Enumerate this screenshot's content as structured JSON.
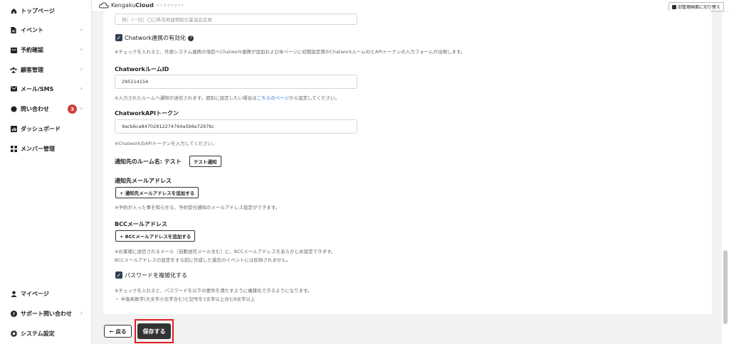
{
  "sidebar": {
    "items": [
      {
        "label": "トップページ",
        "icon": "home-icon"
      },
      {
        "label": "イベント",
        "icon": "document-icon",
        "chevron": "›"
      },
      {
        "label": "予約確認",
        "icon": "calendar-icon",
        "chevron": "›"
      },
      {
        "label": "顧客管理",
        "icon": "users-icon",
        "chevron": "›"
      },
      {
        "label": "メール/SMS",
        "icon": "mail-icon",
        "chevron": "›"
      },
      {
        "label": "問い合わせ",
        "icon": "chat-icon",
        "chevron": "›",
        "badge": "3"
      },
      {
        "label": "ダッシュボード",
        "icon": "chart-icon"
      },
      {
        "label": "メンバー管理",
        "icon": "grid-icon"
      }
    ],
    "bottom_items": [
      {
        "label": "マイページ",
        "icon": "person-icon"
      },
      {
        "label": "サポート問い合わせ",
        "icon": "question-icon",
        "chevron": "›"
      },
      {
        "label": "システム設定",
        "icon": "gear-icon"
      }
    ]
  },
  "header": {
    "logo_prefix": "Kengaku",
    "logo_bold": "Cloud",
    "logo_sub": "ケンガククラウド",
    "switch_label": "旧管理画面に切り替え"
  },
  "form": {
    "org_placeholder": "例）（一社）〇〇県宅地建物取引業協会会員",
    "chatwork_enable_label": "Chatwork連携の有効化",
    "chatwork_enable_note": "※チェックを入れると、外部システム連携の項目へChatwork連携が追加および本ページに初期設定用のChatworkルームIDとAPIトークンの入力フォームが出現します。",
    "room_id_label": "ChatworkルームID",
    "room_id_value": "295114154",
    "room_id_note_prefix": "※入力されたルームへ通知が送信されます。個別に設定したい場合は",
    "room_id_note_link": "こちらのページ",
    "room_id_note_suffix": "から設定してください。",
    "api_token_label": "ChatworkAPIトークン",
    "api_token_value": "9acb6ca84702812274764a5b6e7297bc",
    "api_token_note": "※ChatworkのAPIトークンを入力してください。",
    "room_name_label": "通知先のルーム名: テスト",
    "test_notify_label": "テスト通知",
    "notify_email_label": "通知先メールアドレス",
    "add_notify_email_label": "+ 通知先メールアドレスを追加する",
    "notify_email_note": "※予約が入った事を知らせる、予約受付通知のメールアドレス設定ができます。",
    "bcc_label": "BCCメールアドレス",
    "add_bcc_label": "+ BCCメールアドレスを追加する",
    "bcc_note_1": "※お客様に送信されるメール（自動送信メール含む）に、BCCメールアドレスをあらかじめ設定できます。",
    "bcc_note_2": "BCCメールアドレスの設定をする前に作成した過去のイベントには反映されません。",
    "password_label": "パスワードを複雑化する",
    "password_note_1": "※チェックを入れると、パスワードを以下の要件を満たすように複雑化できるようになります。",
    "password_note_2": "・ 半角英数字(大文字小文字含む)と記号を1文字以上含む8文字以上"
  },
  "footer": {
    "back_label": "← 戻る",
    "save_label": "保存する"
  },
  "colors": {
    "primary_dark": "#333333",
    "badge": "#d0403a",
    "link": "#2a6fd6",
    "highlight": "#e02020"
  }
}
